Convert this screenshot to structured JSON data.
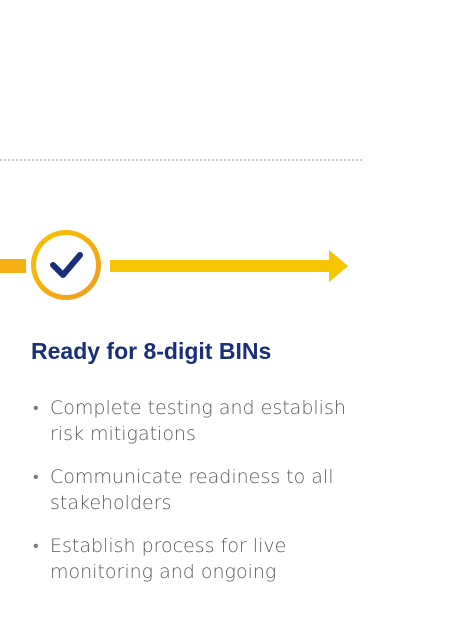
{
  "step": {
    "heading": "Ready for 8-digit BINs",
    "status_icon": "checkmark-icon",
    "bullets": [
      "Complete testing and establish risk mitigations",
      "Communicate readiness to all stakeholders",
      "Establish process for live monitoring and ongoing"
    ]
  },
  "colors": {
    "accent_yellow": "#f7c400",
    "accent_orange": "#f5a623",
    "heading_blue": "#1a2f7a",
    "body_gray": "#5a5a5a",
    "divider_gray": "#c8c8c8"
  }
}
